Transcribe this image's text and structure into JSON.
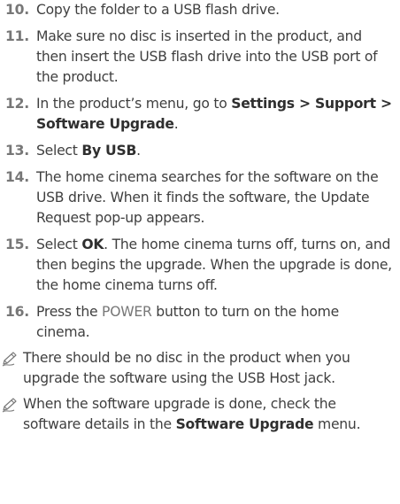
{
  "steps": [
    {
      "num": "10.",
      "parts": [
        {
          "text": "Copy the folder to a USB flash drive."
        }
      ]
    },
    {
      "num": "11.",
      "parts": [
        {
          "text": "Make sure no disc is inserted in the product, and then insert the USB flash drive into the USB port of the product."
        }
      ]
    },
    {
      "num": "12.",
      "parts": [
        {
          "text": "In the product’s menu, go to "
        },
        {
          "text": "Settings",
          "bold": true
        },
        {
          "text": " > ",
          "bold": true
        },
        {
          "text": "Support",
          "bold": true
        },
        {
          "text": " > ",
          "bold": true
        },
        {
          "text": "Software Upgrade",
          "bold": true
        },
        {
          "text": "."
        }
      ]
    },
    {
      "num": "13.",
      "parts": [
        {
          "text": "Select "
        },
        {
          "text": "By USB",
          "bold": true
        },
        {
          "text": "."
        }
      ]
    },
    {
      "num": "14.",
      "parts": [
        {
          "text": "The home cinema searches for the software on the USB drive. When it finds the software, the Update Request pop-up appears."
        }
      ]
    },
    {
      "num": "15.",
      "parts": [
        {
          "text": "Select "
        },
        {
          "text": "OK",
          "bold": true
        },
        {
          "text": ". The home cinema turns off, turns on, and then begins the upgrade. When the upgrade is done, the home cinema turns off."
        }
      ]
    },
    {
      "num": "16.",
      "parts": [
        {
          "text": "Press the "
        },
        {
          "text": "POWER",
          "accent": true
        },
        {
          "text": " button to turn on the home cinema."
        }
      ]
    }
  ],
  "notes": [
    {
      "icon": "pencil-note-icon",
      "parts": [
        {
          "text": "There should be no disc in the product when you upgrade the software using the USB Host jack."
        }
      ]
    },
    {
      "icon": "pencil-note-icon",
      "parts": [
        {
          "text": "When the software upgrade is done, check the software details in the "
        },
        {
          "text": "Software Upgrade",
          "bold": true
        },
        {
          "text": " menu."
        }
      ]
    }
  ],
  "colors": {
    "text": "#3f3f3f",
    "number": "#777777",
    "accent": "#777777"
  }
}
